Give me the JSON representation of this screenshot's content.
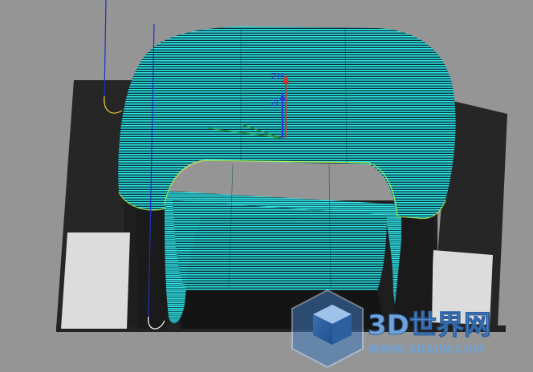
{
  "viewport": {
    "background_color": "#959595",
    "toolpath_color": "#2ee6e6",
    "part_color": "#262626",
    "face_color": "#dcdcdc"
  },
  "triad": {
    "label_top": "ZM",
    "label_mid": "ZC",
    "zm_color": "#d8332b",
    "zc_color": "#2a3dd6"
  },
  "watermark": {
    "title": "3D世界网",
    "url": "WWW.3DSJW.COM",
    "accent_color": "#5d97d2"
  }
}
